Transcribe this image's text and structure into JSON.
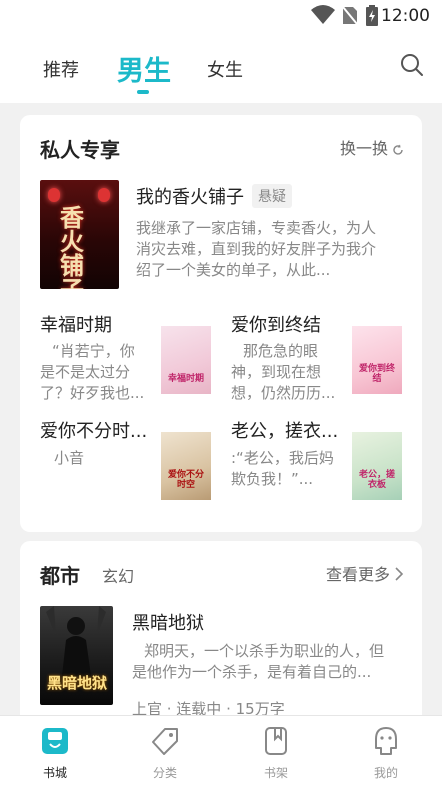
{
  "status_bar": {
    "time": "12:00"
  },
  "top_tabs": [
    {
      "label": "推荐"
    },
    {
      "label": "男生"
    },
    {
      "label": "女生"
    }
  ],
  "private_section": {
    "title": "私人专享",
    "refresh_label": "换一换",
    "featured": {
      "title": "我的香火铺子",
      "tag": "悬疑",
      "desc": "我继承了一家店铺，专卖香火，为人消灾去难，直到我的好友胖子为我介绍了一个美女的单子，从此...",
      "cover_text": "香火铺子"
    },
    "books": [
      {
        "title": "幸福时期",
        "desc": "“肖若宁，你是不是太过分了？好歹我也...",
        "cover_text": "幸福时期"
      },
      {
        "title": "爱你到终结",
        "desc": "那危急的眼神，到现在想想，仍然历历...",
        "cover_text": "爱你到终结"
      },
      {
        "title": "爱你不分时...",
        "desc": "小音",
        "cover_text": "爱你不分时空"
      },
      {
        "title": "老公，搓衣...",
        "desc": ":“老公，我后妈欺负我！”...",
        "cover_text": "老公，搓衣板"
      }
    ]
  },
  "city_section": {
    "title": "都市",
    "sub_tab": "玄幻",
    "more_label": "查看更多",
    "book": {
      "title": "黑暗地狱",
      "desc": "郑明天，一个以杀手为职业的人，但是他作为一个杀手，是有着自己的...",
      "meta": "上官 · 连载中 · 15万字",
      "cover_text": "黑暗地狱"
    }
  },
  "bottom_nav": [
    {
      "label": "书城",
      "icon": "bookstore-icon"
    },
    {
      "label": "分类",
      "icon": "tag-icon"
    },
    {
      "label": "书架",
      "icon": "bookshelf-icon"
    },
    {
      "label": "我的",
      "icon": "profile-icon"
    }
  ],
  "colors": {
    "accent": "#1cb9c9",
    "text": "#222222",
    "muted": "#888888"
  }
}
